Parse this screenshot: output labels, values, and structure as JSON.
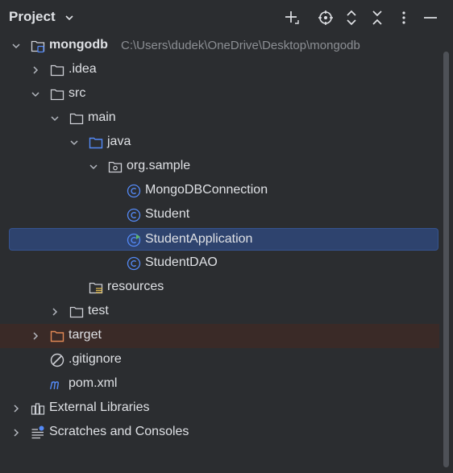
{
  "header": {
    "title": "Project",
    "chevron_icon": "chevron-down-icon",
    "buttons": [
      "plus-icon",
      "locate-icon",
      "expand-all-icon",
      "collapse-all-icon",
      "more-vertical-icon",
      "minimize-icon"
    ]
  },
  "tree": [
    {
      "label": "mongodb",
      "path": "C:\\Users\\dudek\\OneDrive\\Desktop\\mongodb",
      "icon": "module-folder-icon",
      "expanded": true
    },
    {
      "label": ".idea",
      "icon": "folder-icon",
      "expanded": false
    },
    {
      "label": "src",
      "icon": "folder-icon",
      "expanded": true
    },
    {
      "label": "main",
      "icon": "folder-icon",
      "expanded": true
    },
    {
      "label": "java",
      "icon": "source-folder-icon",
      "expanded": true
    },
    {
      "label": "org.sample",
      "icon": "package-icon",
      "expanded": true
    },
    {
      "label": "MongoDBConnection",
      "icon": "java-class-icon"
    },
    {
      "label": "Student",
      "icon": "java-class-icon"
    },
    {
      "label": "StudentApplication",
      "icon": "java-runnable-class-icon",
      "selected": true
    },
    {
      "label": "StudentDAO",
      "icon": "java-class-icon"
    },
    {
      "label": "resources",
      "icon": "resources-folder-icon"
    },
    {
      "label": "test",
      "icon": "folder-icon",
      "expanded": false
    },
    {
      "label": "target",
      "icon": "excluded-folder-icon",
      "expanded": false
    },
    {
      "label": ".gitignore",
      "icon": "ignored-file-icon"
    },
    {
      "label": "pom.xml",
      "icon": "maven-icon"
    },
    {
      "label": "External Libraries",
      "icon": "libraries-icon",
      "expanded": false
    },
    {
      "label": "Scratches and Consoles",
      "icon": "scratches-icon",
      "expanded": false
    }
  ],
  "colors": {
    "background": "#2b2d30",
    "selection": "#2e436e",
    "excluded_row": "#3a2a27",
    "class_icon": "#548af7",
    "run_badge": "#5fb865",
    "excluded_folder": "#e08855"
  }
}
